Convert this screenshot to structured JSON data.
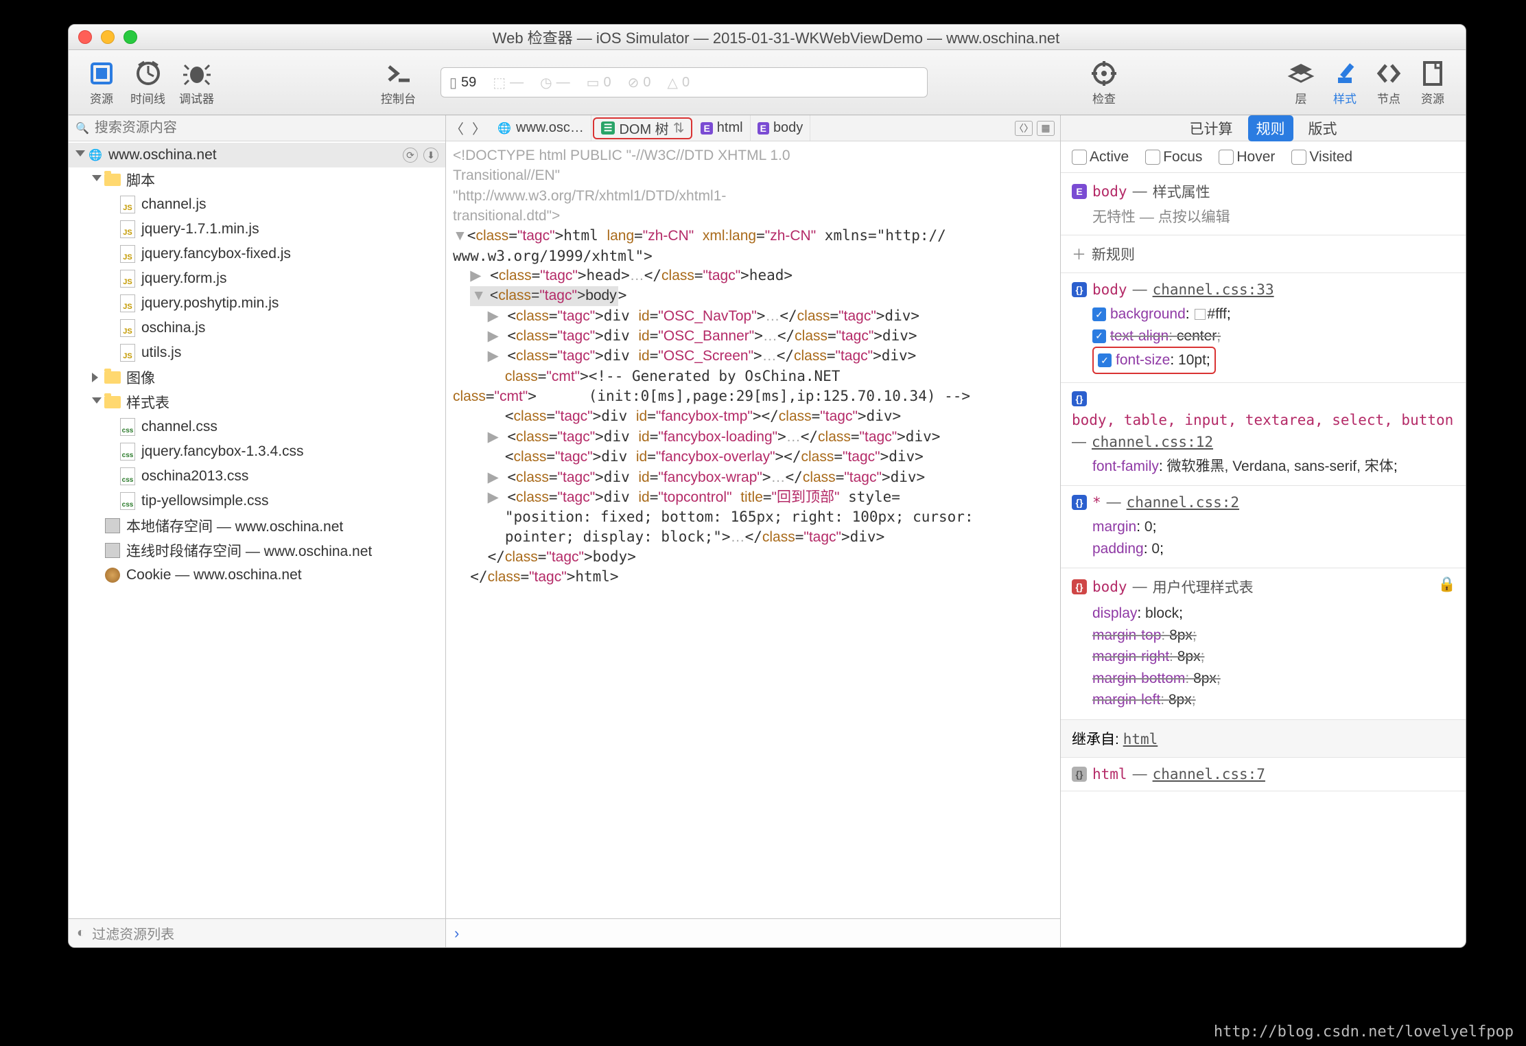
{
  "window": {
    "title": "Web 检查器 — iOS Simulator — 2015-01-31-WKWebViewDemo — www.oschina.net"
  },
  "toolbar": {
    "resources": "资源",
    "timelines": "时间线",
    "debugger": "调试器",
    "console": "控制台",
    "inspect": "检查",
    "layers": "层",
    "styles": "样式",
    "node": "节点",
    "right_resources": "资源",
    "info_file_count": "59",
    "info_errors": "0",
    "info_logs": "0",
    "info_warnings": "0"
  },
  "search": {
    "placeholder": "搜索资源内容"
  },
  "tree": {
    "root": "www.oschina.net",
    "scripts_label": "脚本",
    "scripts": [
      "channel.js",
      "jquery-1.7.1.min.js",
      "jquery.fancybox-fixed.js",
      "jquery.form.js",
      "jquery.poshytip.min.js",
      "oschina.js",
      "utils.js"
    ],
    "images_label": "图像",
    "stylesheets_label": "样式表",
    "stylesheets": [
      "channel.css",
      "jquery.fancybox-1.3.4.css",
      "oschina2013.css",
      "tip-yellowsimple.css"
    ],
    "local_storage": "本地储存空间 — www.oschina.net",
    "session_storage": "连线时段储存空间 — www.oschina.net",
    "cookie": "Cookie — www.oschina.net"
  },
  "filter": {
    "placeholder": "过滤资源列表"
  },
  "breadcrumb": {
    "site": "www.osc…",
    "dom_tree": "DOM 树",
    "html": "html",
    "body": "body"
  },
  "dom_code": "<!DOCTYPE html PUBLIC \"-//W3C//DTD XHTML 1.0\nTransitional//EN\"\n\"http://www.w3.org/TR/xhtml1/DTD/xhtml1-\ntransitional.dtd\">\n▼<html lang=\"zh-CN\" xml:lang=\"zh-CN\" xmlns=\"http://\nwww.w3.org/1999/xhtml\">\n  ▶ <head>…</head>\n  ▼ <body>\n    ▶ <div id=\"OSC_NavTop\">…</div>\n    ▶ <div id=\"OSC_Banner\">…</div>\n    ▶ <div id=\"OSC_Screen\">…</div>\n      <!-- Generated by OsChina.NET\n      (init:0[ms],page:29[ms],ip:125.70.10.34) -->\n      <div id=\"fancybox-tmp\"></div>\n    ▶ <div id=\"fancybox-loading\">…</div>\n      <div id=\"fancybox-overlay\"></div>\n    ▶ <div id=\"fancybox-wrap\">…</div>\n    ▶ <div id=\"topcontrol\" title=\"回到顶部\" style=\n      \"position: fixed; bottom: 165px; right: 100px; cursor:\n      pointer; display: block;\">…</div>\n    </body>\n  </html>",
  "right": {
    "tabs": {
      "computed": "已计算",
      "rules": "规则",
      "metrics": "版式"
    },
    "pseudo": {
      "active": "Active",
      "focus": "Focus",
      "hover": "Hover",
      "visited": "Visited"
    },
    "attr_section": {
      "selector": "body",
      "title": "样式属性",
      "sub": "无特性 — 点按以编辑"
    },
    "new_rule": "新规则",
    "rule1": {
      "selector": "body",
      "src": "channel.css:33",
      "p1": {
        "name": "background",
        "val": "#fff"
      },
      "p2": {
        "name": "text-align",
        "val": "center"
      },
      "p3": {
        "name": "font-size",
        "val": "10pt"
      }
    },
    "rule2": {
      "selector": "body, table, input, textarea, select, button",
      "src": "channel.css:12",
      "p1": {
        "name": "font-family",
        "val": "微软雅黑, Verdana, sans-serif, 宋体"
      }
    },
    "rule3": {
      "selector": "*",
      "src": "channel.css:2",
      "p1": {
        "name": "margin",
        "val": "0"
      },
      "p2": {
        "name": "padding",
        "val": "0"
      }
    },
    "rule_ua": {
      "selector": "body",
      "src": "用户代理样式表",
      "p1": {
        "name": "display",
        "val": "block"
      },
      "p2": {
        "name": "margin-top",
        "val": "8px"
      },
      "p3": {
        "name": "margin-right",
        "val": "8px"
      },
      "p4": {
        "name": "margin-bottom",
        "val": "8px"
      },
      "p5": {
        "name": "margin-left",
        "val": "8px"
      }
    },
    "inherit_label": "继承自:",
    "inherit_from": "html",
    "rule_html": {
      "selector": "html",
      "src": "channel.css:7"
    }
  },
  "watermark": "http://blog.csdn.net/lovelyelfpop"
}
